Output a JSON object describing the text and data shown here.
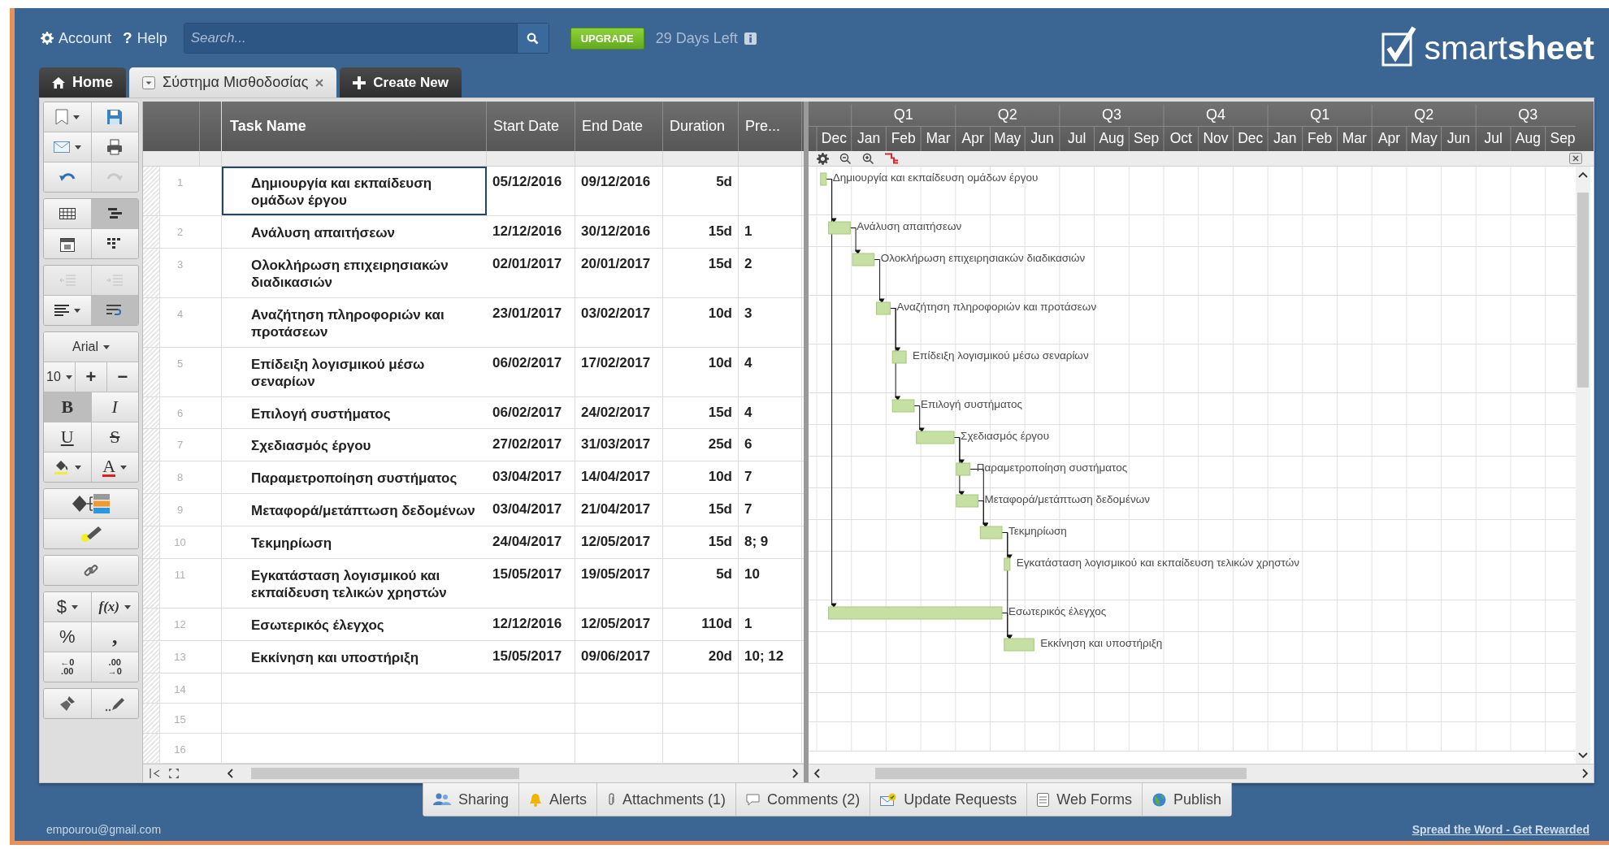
{
  "header": {
    "account": "Account",
    "help_glyph": "?",
    "help": "Help",
    "search": {
      "placeholder": "Search..."
    },
    "upgrade": "UPGRADE",
    "trial": "29 Days Left",
    "logo": "smart**sheet**"
  },
  "tabs": [
    {
      "kind": "home",
      "label": "Home",
      "selected": false
    },
    {
      "kind": "sheet",
      "label": "Σύστημα Μισθοδοσίας",
      "selected": true
    },
    {
      "kind": "new",
      "label": "Create New",
      "selected": false
    }
  ],
  "toolbar": [
    [
      [
        {
          "kind": "page",
          "dropdown": true,
          "selected": false,
          "disabled": false
        },
        {
          "kind": "disk",
          "dropdown": false,
          "selected": false,
          "disabled": false
        }
      ],
      [
        {
          "kind": "envelope",
          "dropdown": true,
          "selected": false,
          "disabled": false
        },
        {
          "kind": "printer",
          "dropdown": false,
          "selected": false,
          "disabled": false
        }
      ],
      [
        {
          "kind": "undo",
          "dropdown": false,
          "selected": false,
          "disabled": false
        },
        {
          "kind": "redo",
          "dropdown": false,
          "selected": false,
          "disabled": true
        }
      ]
    ],
    [
      [
        {
          "kind": "grid",
          "dropdown": false,
          "selected": false,
          "disabled": false
        },
        {
          "kind": "gantt",
          "dropdown": false,
          "selected": true,
          "disabled": false
        }
      ],
      [
        {
          "kind": "calendar",
          "dropdown": false,
          "selected": false,
          "disabled": false
        },
        {
          "kind": "cards",
          "dropdown": false,
          "selected": false,
          "disabled": false
        }
      ]
    ],
    [
      [
        {
          "kind": "outdent",
          "dropdown": false,
          "selected": false,
          "disabled": true
        },
        {
          "kind": "indent",
          "dropdown": false,
          "selected": false,
          "disabled": true
        }
      ],
      [
        {
          "kind": "align",
          "dropdown": true,
          "selected": false,
          "disabled": false
        },
        {
          "kind": "wrap",
          "dropdown": false,
          "selected": true,
          "disabled": false
        }
      ]
    ],
    [
      [
        {
          "kind": "font",
          "label": "Arial",
          "dropdown": true,
          "selected": false,
          "disabled": false
        }
      ],
      [
        {
          "kind": "size",
          "label": "10",
          "dropdown": true,
          "selected": false,
          "disabled": false
        },
        {
          "kind": "plus",
          "label": "+",
          "dropdown": false,
          "selected": false,
          "disabled": false
        },
        {
          "kind": "minus",
          "label": "−",
          "dropdown": false,
          "selected": false,
          "disabled": false
        }
      ],
      [
        {
          "kind": "bold",
          "label": "B",
          "dropdown": false,
          "selected": true,
          "disabled": false
        },
        {
          "kind": "italic",
          "label": "I",
          "dropdown": false,
          "selected": false,
          "disabled": false
        }
      ],
      [
        {
          "kind": "underline",
          "label": "U",
          "dropdown": false,
          "selected": false,
          "disabled": false
        },
        {
          "kind": "strike",
          "label": "S",
          "dropdown": false,
          "selected": false,
          "disabled": false
        }
      ],
      [
        {
          "kind": "fill",
          "dropdown": true,
          "selected": false,
          "disabled": false
        },
        {
          "kind": "color",
          "label": "A",
          "dropdown": true,
          "selected": false,
          "disabled": false
        }
      ]
    ],
    [
      [
        {
          "kind": "rules",
          "dropdown": false,
          "selected": false,
          "disabled": false
        }
      ],
      [
        {
          "kind": "highlight",
          "dropdown": false,
          "selected": false,
          "disabled": false
        }
      ]
    ],
    [
      [
        {
          "kind": "link",
          "dropdown": false,
          "selected": false,
          "disabled": false
        }
      ]
    ],
    [
      [
        {
          "kind": "currency",
          "label": "$",
          "dropdown": true,
          "selected": false,
          "disabled": false
        },
        {
          "kind": "formula",
          "label": "f(x)",
          "dropdown": true,
          "selected": false,
          "disabled": false
        }
      ],
      [
        {
          "kind": "percent",
          "label": "%",
          "dropdown": false,
          "selected": false,
          "disabled": false
        },
        {
          "kind": "comma",
          "label": ",",
          "dropdown": false,
          "selected": false,
          "disabled": false
        }
      ],
      [
        {
          "kind": "decimals",
          "lines": [
            "←0",
            ".00"
          ],
          "dropdown": false,
          "selected": false,
          "disabled": false
        },
        {
          "kind": "decimals",
          "lines": [
            ".00",
            "→0"
          ],
          "dropdown": false,
          "selected": false,
          "disabled": false
        }
      ]
    ],
    [
      [
        {
          "kind": "clear",
          "dropdown": false,
          "selected": false,
          "disabled": false
        },
        {
          "kind": "painter",
          "dropdown": false,
          "selected": false,
          "disabled": false
        }
      ]
    ]
  ],
  "grid": {
    "columns": [
      "Task Name",
      "Start Date",
      "End Date",
      "Duration",
      "Pre..."
    ],
    "rows": [
      {
        "number": "1",
        "task": "Δημιουργία και εκπαίδευση ομάδων έργου",
        "start": "05/12/2016",
        "end": "09/12/2016",
        "duration": "5d",
        "bar_label": "Δημιουργία και εκπαίδευση ομάδων έργου",
        "selected": true
      },
      {
        "number": "2",
        "task": "Ανάλυση απαιτήσεων",
        "start": "12/12/2016",
        "end": "30/12/2016",
        "duration": "15d",
        "pre": "1",
        "bar_label": "Ανάλυση απαιτήσεων",
        "selected": false
      },
      {
        "number": "3",
        "task": "Ολοκλήρωση επιχειρησιακών διαδικασιών",
        "start": "02/01/2017",
        "end": "20/01/2017",
        "duration": "15d",
        "pre": "2",
        "bar_label": "Ολοκλήρωση επιχειρησιακών διαδικασιών",
        "selected": false
      },
      {
        "number": "4",
        "task": "Αναζήτηση πληροφοριών και προτάσεων",
        "start": "23/01/2017",
        "end": "03/02/2017",
        "duration": "10d",
        "pre": "3",
        "bar_label": "Αναζήτηση πληροφοριών και προτάσεων",
        "selected": false
      },
      {
        "number": "5",
        "task": "Επίδειξη λογισμικού μέσω σεναρίων",
        "start": "06/02/2017",
        "end": "17/02/2017",
        "duration": "10d",
        "pre": "4",
        "bar_label": "Επίδειξη λογισμικού μέσω σεναρίων",
        "selected": false
      },
      {
        "number": "6",
        "task": "Επιλογή συστήματος",
        "start": "06/02/2017",
        "end": "24/02/2017",
        "duration": "15d",
        "pre": "4",
        "bar_label": "Επιλογή συστήματος",
        "selected": false
      },
      {
        "number": "7",
        "task": "Σχεδιασμός έργου",
        "start": "27/02/2017",
        "end": "31/03/2017",
        "duration": "25d",
        "pre": "6",
        "bar_label": "Σχεδιασμός έργου",
        "selected": false
      },
      {
        "number": "8",
        "task": "Παραμετροποίηση συστήματος",
        "start": "03/04/2017",
        "end": "14/04/2017",
        "duration": "10d",
        "pre": "7",
        "bar_label": "Παραμετροποίηση συστήματος",
        "selected": false
      },
      {
        "number": "9",
        "task": "Μεταφορά/μετάπτωση δεδομένων",
        "start": "03/04/2017",
        "end": "21/04/2017",
        "duration": "15d",
        "pre": "7",
        "bar_label": "Μεταφορά/μετάπτωση δεδομένων",
        "selected": false
      },
      {
        "number": "10",
        "task": "Τεκμηρίωση",
        "start": "24/04/2017",
        "end": "12/05/2017",
        "duration": "15d",
        "pre": "8; 9",
        "bar_label": "Τεκμηρίωση",
        "selected": false
      },
      {
        "number": "11",
        "task": "Εγκατάσταση λογισμικού και εκπαίδευση τελικών χρηστών",
        "start": "15/05/2017",
        "end": "19/05/2017",
        "duration": "5d",
        "pre": "10",
        "bar_label": "Εγκατάσταση λογισμικού και εκπαίδευση τελικών χρηστών",
        "selected": false
      },
      {
        "number": "12",
        "task": "Εσωτερικός έλεγχος",
        "start": "12/12/2016",
        "end": "12/05/2017",
        "duration": "110d",
        "pre": "1",
        "bar_label": "Εσωτερικός έλεγχος",
        "selected": false
      },
      {
        "number": "13",
        "task": "Εκκίνηση και υποστήριξη",
        "start": "15/05/2017",
        "end": "09/06/2017",
        "duration": "20d",
        "pre": "10; 12",
        "bar_label": "Εκκίνηση και υποστήριξη",
        "selected": false
      },
      {
        "number": "14",
        "selected": false
      },
      {
        "number": "15",
        "selected": false
      },
      {
        "number": "16",
        "selected": false
      }
    ]
  },
  "gantt": {
    "quarters": [
      "Q1",
      "Q2",
      "Q3",
      "Q4",
      "Q1",
      "Q2",
      "Q3"
    ],
    "months": [
      "Dec",
      "Jan",
      "Feb",
      "Mar",
      "Apr",
      "May",
      "Jun",
      "Jul",
      "Aug",
      "Sep",
      "Oct",
      "Nov",
      "Dec",
      "Jan",
      "Feb",
      "Mar",
      "Apr",
      "May",
      "Jun",
      "Jul",
      "Aug",
      "Sep"
    ]
  },
  "bottom_tabs": [
    {
      "kind": "sharing",
      "label": "Sharing"
    },
    {
      "kind": "alerts",
      "label": "Alerts"
    },
    {
      "kind": "attachments",
      "label": "Attachments (1)"
    },
    {
      "kind": "comments",
      "label": "Comments (2)"
    },
    {
      "kind": "requests",
      "label": "Update Requests"
    },
    {
      "kind": "forms",
      "label": "Web Forms"
    },
    {
      "kind": "publish",
      "label": "Publish"
    }
  ],
  "footer": {
    "email": "empourou@gmail.com",
    "link": "Spread the Word - Get Rewarded"
  }
}
